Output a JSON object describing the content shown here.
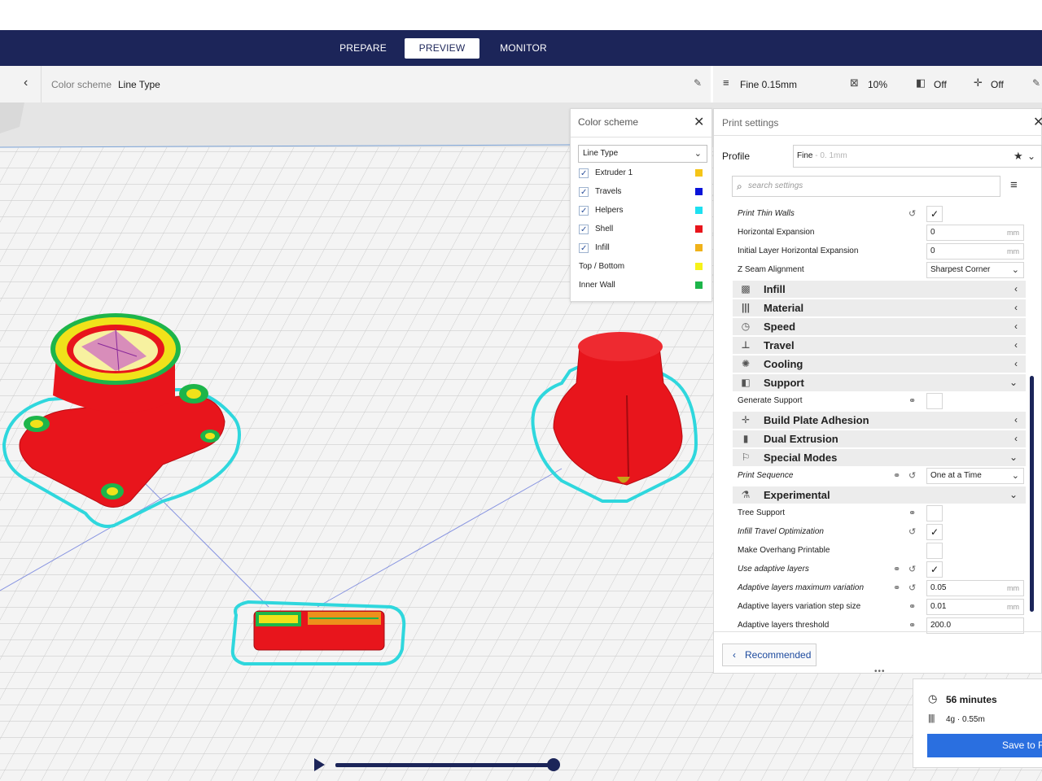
{
  "nav": {
    "tabs": [
      "PREPARE",
      "PREVIEW",
      "MONITOR"
    ],
    "active": "PREVIEW"
  },
  "header": {
    "color_scheme_label": "Color scheme",
    "color_scheme_value": "Line Type",
    "profile_quality": "Fine 0.15mm",
    "infill": "10%",
    "support": "Off",
    "adhesion": "Off"
  },
  "color_scheme_panel": {
    "title": "Color scheme",
    "dropdown": "Line Type",
    "items": [
      {
        "label": "Extruder 1",
        "checked": true,
        "color": "#f5c518"
      },
      {
        "label": "Travels",
        "checked": true,
        "color": "#0a14d9"
      },
      {
        "label": "Helpers",
        "checked": true,
        "color": "#1ee0f0"
      },
      {
        "label": "Shell",
        "checked": true,
        "color": "#e8151c"
      },
      {
        "label": "Infill",
        "checked": true,
        "color": "#f0b21a"
      },
      {
        "label": "Top / Bottom",
        "checked": null,
        "color": "#f6f21a"
      },
      {
        "label": "Inner Wall",
        "checked": null,
        "color": "#1db54a"
      }
    ]
  },
  "print_settings": {
    "title": "Print settings",
    "profile_label": "Profile",
    "profile_value": "Fine",
    "profile_hint": "- 0. 1mm",
    "search_placeholder": "search settings",
    "rows": [
      {
        "type": "setting",
        "label": "Print Thin Walls",
        "italic": true,
        "reset": true,
        "control": "check",
        "checked": true
      },
      {
        "type": "setting",
        "label": "Horizontal Expansion",
        "control": "input",
        "value": "0",
        "unit": "mm"
      },
      {
        "type": "setting",
        "label": "Initial Layer Horizontal Expansion",
        "control": "input",
        "value": "0",
        "unit": "mm"
      },
      {
        "type": "setting",
        "label": "Z Seam Alignment",
        "control": "select",
        "value": "Sharpest Corner"
      },
      {
        "type": "category",
        "label": "Infill",
        "icon": "▩",
        "arrow": "‹"
      },
      {
        "type": "category",
        "label": "Material",
        "icon": "|||",
        "arrow": "‹"
      },
      {
        "type": "category",
        "label": "Speed",
        "icon": "◷",
        "arrow": "‹"
      },
      {
        "type": "category",
        "label": "Travel",
        "icon": "⊥",
        "arrow": "‹"
      },
      {
        "type": "category",
        "label": "Cooling",
        "icon": "✺",
        "arrow": "‹"
      },
      {
        "type": "category",
        "label": "Support",
        "icon": "◧",
        "arrow": "⌄"
      },
      {
        "type": "setting",
        "label": "Generate Support",
        "link": true,
        "control": "check",
        "checked": false
      },
      {
        "type": "category",
        "label": "Build Plate Adhesion",
        "icon": "✛",
        "arrow": "‹"
      },
      {
        "type": "category",
        "label": "Dual Extrusion",
        "icon": "▮",
        "arrow": "‹"
      },
      {
        "type": "category",
        "label": "Special Modes",
        "icon": "⚐",
        "arrow": "⌄"
      },
      {
        "type": "setting",
        "label": "Print Sequence",
        "italic": true,
        "link": true,
        "reset": true,
        "control": "select",
        "value": "One at a Time"
      },
      {
        "type": "category",
        "label": "Experimental",
        "icon": "⚗",
        "arrow": "⌄"
      },
      {
        "type": "setting",
        "label": "Tree Support",
        "link": true,
        "control": "check",
        "checked": false
      },
      {
        "type": "setting",
        "label": "Infill Travel Optimization",
        "italic": true,
        "reset": true,
        "control": "check",
        "checked": true
      },
      {
        "type": "setting",
        "label": "Make Overhang Printable",
        "control": "check",
        "checked": false
      },
      {
        "type": "setting",
        "label": "Use adaptive layers",
        "italic": true,
        "link": true,
        "reset": true,
        "control": "check",
        "checked": true
      },
      {
        "type": "setting",
        "label": "Adaptive layers maximum variation",
        "italic": true,
        "link": true,
        "reset": true,
        "control": "input",
        "value": "0.05",
        "unit": "mm"
      },
      {
        "type": "setting",
        "label": "Adaptive layers variation step size",
        "link": true,
        "control": "input",
        "value": "0.01",
        "unit": "mm"
      },
      {
        "type": "setting",
        "label": "Adaptive layers threshold",
        "link": true,
        "control": "input",
        "value": "200.0",
        "unit": ""
      }
    ],
    "recommended_label": "Recommended"
  },
  "estimate": {
    "time": "56 minutes",
    "material": "4g · 0.55m",
    "save_label": "Save to F"
  },
  "scene_colors": {
    "shell": "#e8151c",
    "skirt": "#2fd7dd",
    "infill": "#f0e21a",
    "wall": "#1db54a"
  }
}
